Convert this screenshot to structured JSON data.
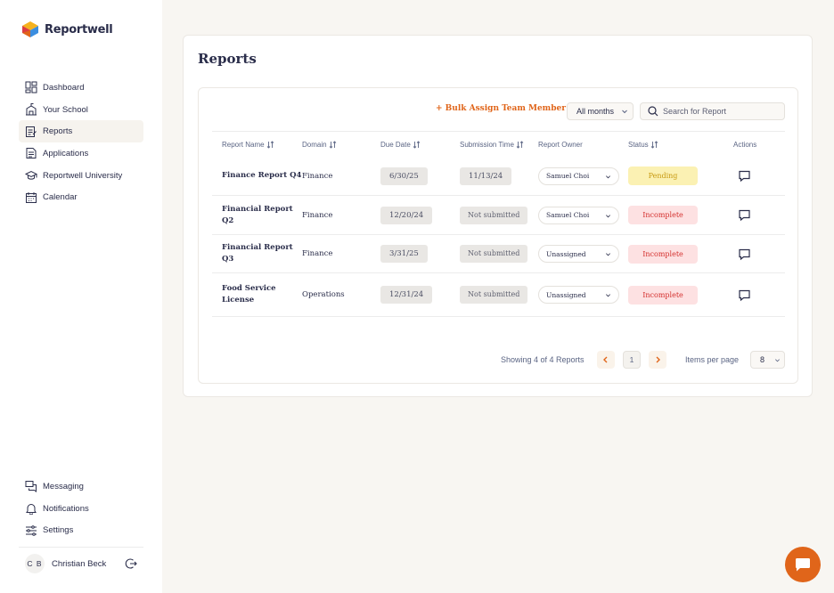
{
  "app": {
    "brand": "Reportwell",
    "accent_color": "#e0651a",
    "text_color": "#2a2d4a"
  },
  "sidebar": {
    "items": [
      {
        "label": "Dashboard",
        "icon": "dashboard-icon"
      },
      {
        "label": "Your School",
        "icon": "school-icon"
      },
      {
        "label": "Reports",
        "icon": "reports-icon",
        "active": true
      },
      {
        "label": "Applications",
        "icon": "applications-icon"
      },
      {
        "label": "Reportwell University",
        "icon": "graduation-cap-icon"
      },
      {
        "label": "Calendar",
        "icon": "calendar-icon"
      }
    ],
    "bottom_items": [
      {
        "label": "Messaging",
        "icon": "messaging-icon"
      },
      {
        "label": "Notifications",
        "icon": "bell-icon"
      },
      {
        "label": "Settings",
        "icon": "settings-icon"
      }
    ],
    "user": {
      "initials": "C B",
      "name": "Christian Beck"
    }
  },
  "page": {
    "title": "Reports"
  },
  "toolbar": {
    "bulk_assign_label": "+ Bulk Assign Team Member",
    "month_filter_value": "All months",
    "search_placeholder": "Search for Report"
  },
  "table": {
    "columns": [
      "Report Name",
      "Domain",
      "Due Date",
      "Submission Time",
      "Report Owner",
      "Status",
      "Actions"
    ],
    "rows": [
      {
        "name": "Finance Report Q4",
        "domain": "Finance",
        "due_date": "6/30/25",
        "submission": "11/13/24",
        "owner": "Samuel Choi",
        "status": "Pending"
      },
      {
        "name": "Financial Report Q2",
        "domain": "Finance",
        "due_date": "12/20/24",
        "submission": "Not submitted",
        "owner": "Samuel Choi",
        "status": "Incomplete"
      },
      {
        "name": "Financial Report Q3",
        "domain": "Finance",
        "due_date": "3/31/25",
        "submission": "Not submitted",
        "owner": "Unassigned",
        "status": "Incomplete"
      },
      {
        "name": "Food Service License",
        "domain": "Operations",
        "due_date": "12/31/24",
        "submission": "Not submitted",
        "owner": "Unassigned",
        "status": "Incomplete"
      }
    ]
  },
  "pagination": {
    "showing_text": "Showing 4 of 4 Reports",
    "current_page": "1",
    "items_per_page_label": "Items per page",
    "items_per_page_value": "8"
  }
}
